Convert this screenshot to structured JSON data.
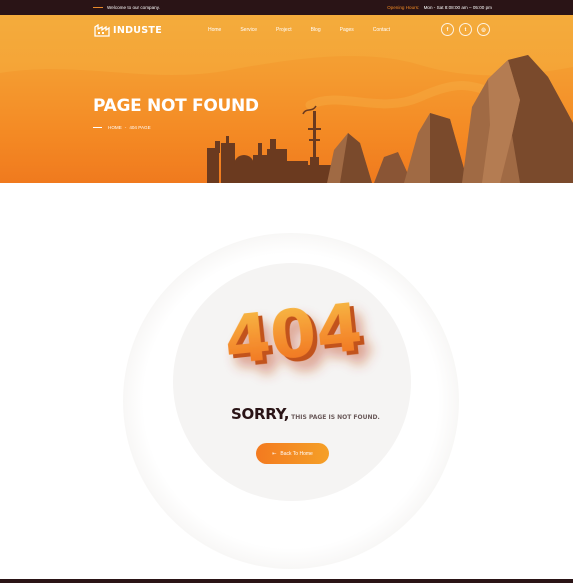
{
  "topbar": {
    "welcome": "Welcome to our company.",
    "hours_label": "Opening Hours:",
    "hours_value": "Mon - Sat 8:08:00 am – 05:00 pm"
  },
  "header": {
    "logo_text": "INDUSTE",
    "nav": [
      "Home",
      "Service",
      "Project",
      "Blog",
      "Pages",
      "Contact"
    ],
    "socials": [
      {
        "icon": "facebook-icon",
        "glyph": "f"
      },
      {
        "icon": "twitter-icon",
        "glyph": "t"
      },
      {
        "icon": "instagram-icon",
        "glyph": "◎"
      }
    ]
  },
  "hero": {
    "title": "PAGE NOT FOUND",
    "breadcrumb": {
      "home": "HOME",
      "separator": "-",
      "current": "404 PAGE"
    }
  },
  "error": {
    "code": "404",
    "headline": "SORRY,",
    "message": "THIS PAGE IS NOT FOUND.",
    "button_label": "Back To Home",
    "button_icon": "arrow-left-icon"
  },
  "colors": {
    "accent": "#f48a24",
    "dark": "#2a1416"
  }
}
